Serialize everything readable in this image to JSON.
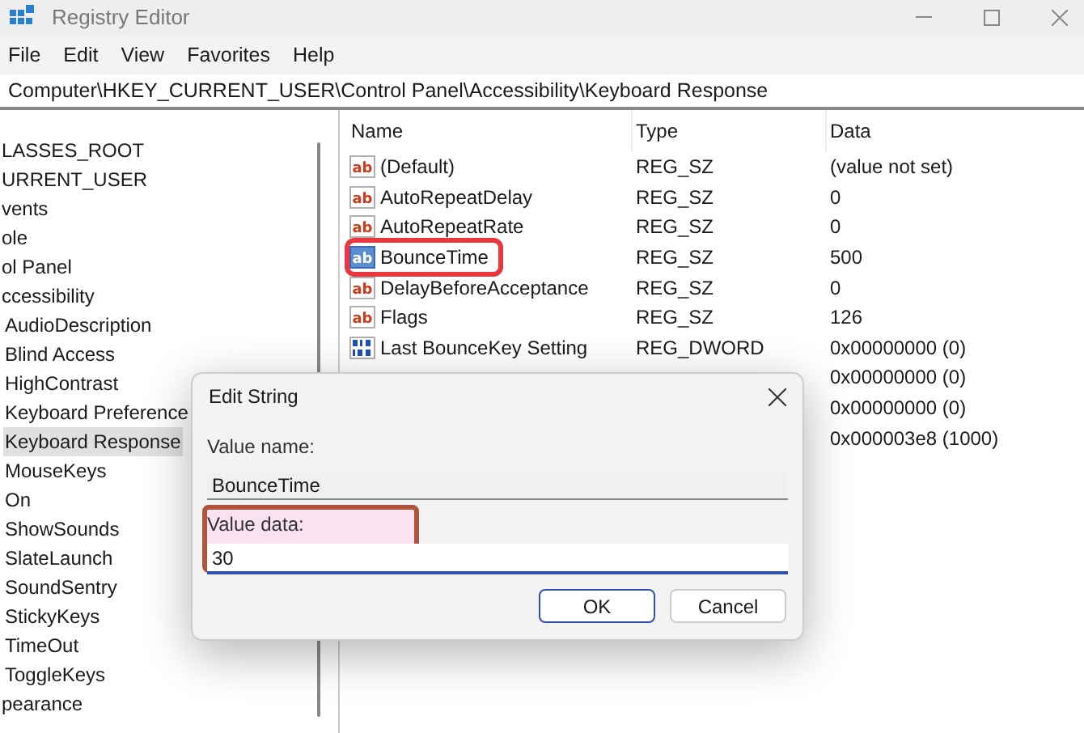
{
  "window": {
    "title": "Registry Editor"
  },
  "menu": [
    "File",
    "Edit",
    "View",
    "Favorites",
    "Help"
  ],
  "address": "Computer\\HKEY_CURRENT_USER\\Control Panel\\Accessibility\\Keyboard Response",
  "tree": [
    {
      "label": "LASSES_ROOT",
      "selected": false
    },
    {
      "label": "URRENT_USER",
      "selected": false
    },
    {
      "label": "vents",
      "selected": false
    },
    {
      "label": "ole",
      "selected": false
    },
    {
      "label": "ol Panel",
      "selected": false
    },
    {
      "label": "ccessibility",
      "selected": false,
      "children": [
        {
          "label": "AudioDescription",
          "selected": false
        },
        {
          "label": "Blind Access",
          "selected": false
        },
        {
          "label": "HighContrast",
          "selected": false
        },
        {
          "label": "Keyboard Preference",
          "selected": false
        },
        {
          "label": "Keyboard Response",
          "selected": true
        },
        {
          "label": "MouseKeys",
          "selected": false
        },
        {
          "label": "On",
          "selected": false
        },
        {
          "label": "ShowSounds",
          "selected": false
        },
        {
          "label": "SlateLaunch",
          "selected": false
        },
        {
          "label": "SoundSentry",
          "selected": false
        },
        {
          "label": "StickyKeys",
          "selected": false
        },
        {
          "label": "TimeOut",
          "selected": false
        },
        {
          "label": "ToggleKeys",
          "selected": false
        }
      ]
    },
    {
      "label": "pearance",
      "selected": false
    }
  ],
  "table": {
    "columns": [
      "Name",
      "Type",
      "Data"
    ],
    "rows": [
      {
        "kind": "string",
        "icon": "ab",
        "name": "(Default)",
        "type": "REG_SZ",
        "data": "(value not set)",
        "selected": false
      },
      {
        "kind": "string",
        "icon": "ab",
        "name": "AutoRepeatDelay",
        "type": "REG_SZ",
        "data": "0",
        "selected": false
      },
      {
        "kind": "string",
        "icon": "ab",
        "name": "AutoRepeatRate",
        "type": "REG_SZ",
        "data": "0",
        "selected": false
      },
      {
        "kind": "string",
        "icon": "ab",
        "name": "BounceTime",
        "type": "REG_SZ",
        "data": "500",
        "selected": true,
        "annotated": true
      },
      {
        "kind": "string",
        "icon": "ab",
        "name": "DelayBeforeAcceptance",
        "type": "REG_SZ",
        "data": "0",
        "selected": false
      },
      {
        "kind": "string",
        "icon": "ab",
        "name": "Flags",
        "type": "REG_SZ",
        "data": "126",
        "selected": false
      },
      {
        "kind": "dword",
        "name": "Last BounceKey Setting",
        "type": "REG_DWORD",
        "data": "0x00000000 (0)"
      },
      {
        "kind": "hidden",
        "data": "0x00000000 (0)"
      },
      {
        "kind": "hidden",
        "data": "0x00000000 (0)"
      },
      {
        "kind": "hidden",
        "data": "0x000003e8 (1000)"
      }
    ]
  },
  "dialog": {
    "title": "Edit String",
    "name_label": "Value name:",
    "name_value": "BounceTime",
    "data_label": "Value data:",
    "data_value": "30",
    "data_annotated": true,
    "buttons": [
      {
        "label": "OK",
        "default": true
      },
      {
        "label": "Cancel",
        "default": false
      }
    ]
  }
}
